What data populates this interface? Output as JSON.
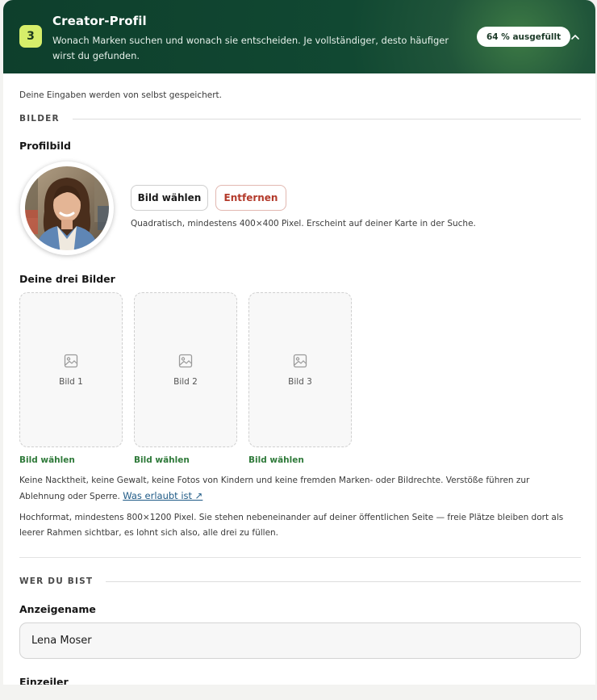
{
  "header": {
    "step": "3",
    "title": "Creator-Profil",
    "subtitle": "Wonach Marken suchen und wonach sie entscheiden. Je vollständiger, desto häufiger wirst du gefunden.",
    "progress_label": "64 % ausgefüllt"
  },
  "autosave_note": "Deine Eingaben werden von selbst gespeichert.",
  "images_section": {
    "heading": "BILDER",
    "profile_label": "Profilbild",
    "choose_button": "Bild wählen",
    "remove_button": "Entfernen",
    "profile_hint": "Quadratisch, mindestens 400×400 Pixel. Erscheint auf deiner Karte in der Suche.",
    "gallery_label": "Deine drei Bilder",
    "slots": [
      {
        "label": "Bild 1",
        "action": "Bild wählen"
      },
      {
        "label": "Bild 2",
        "action": "Bild wählen"
      },
      {
        "label": "Bild 3",
        "action": "Bild wählen"
      }
    ],
    "rules_text": "Keine Nacktheit, keine Gewalt, keine Fotos von Kindern und keine fremden Marken- oder Bildrechte. Verstöße führen zur Ablehnung oder Sperre.",
    "rules_link": "Was erlaubt ist ↗",
    "format_hint": "Hochformat, mindestens 800×1200 Pixel. Sie stehen nebeneinander auf deiner öffentlichen Seite — freie Plätze bleiben dort als leerer Rahmen sichtbar, es lohnt sich also, alle drei zu füllen."
  },
  "identity_section": {
    "heading": "WER DU BIST",
    "display_name_label": "Anzeigename",
    "display_name_value": "Lena Moser",
    "oneliner_label": "Einzeiler"
  },
  "colors": {
    "header_dark": "#0e3f2c",
    "badge": "#d6ee6a",
    "accent_green": "#2f7a3a",
    "danger": "#b33a2b",
    "link": "#1e5a86"
  }
}
